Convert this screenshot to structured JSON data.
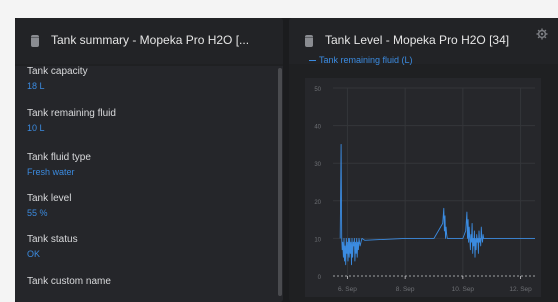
{
  "left_panel": {
    "title": "Tank summary - Mopeka Pro H2O [...",
    "fields": [
      {
        "label": "Tank capacity",
        "value": "18 L"
      },
      {
        "label": "Tank remaining fluid",
        "value": "10 L"
      },
      {
        "label": "Tank fluid type",
        "value": "Fresh water"
      },
      {
        "label": "Tank level",
        "value": "55 %"
      },
      {
        "label": "Tank status",
        "value": "OK"
      },
      {
        "label": "Tank custom name",
        "value": ""
      }
    ]
  },
  "right_panel": {
    "title": "Tank Level - Mopeka Pro H2O [34]",
    "legend": "Tank remaining fluid (L)",
    "icons": {
      "panel": "tank-icon",
      "settings": "gear-icon"
    }
  },
  "chart_data": {
    "type": "line",
    "series": [
      {
        "name": "Tank remaining fluid (L)",
        "x": [
          5.75,
          5.78,
          5.8,
          5.82,
          5.84,
          5.86,
          5.88,
          5.9,
          5.92,
          5.94,
          5.96,
          5.98,
          6.0,
          6.02,
          6.04,
          6.06,
          6.08,
          6.1,
          6.12,
          6.14,
          6.16,
          6.18,
          6.2,
          6.22,
          6.24,
          6.26,
          6.28,
          6.3,
          6.32,
          6.34,
          6.36,
          6.38,
          6.4,
          6.42,
          6.44,
          6.5,
          6.6,
          8.0,
          9.0,
          9.3,
          9.34,
          9.36,
          9.38,
          9.4,
          9.42,
          9.44,
          9.46,
          9.5,
          9.6,
          9.8,
          10.0,
          10.1,
          10.14,
          10.16,
          10.18,
          10.2,
          10.22,
          10.24,
          10.26,
          10.28,
          10.3,
          10.32,
          10.34,
          10.36,
          10.38,
          10.4,
          10.42,
          10.44,
          10.46,
          10.48,
          10.5,
          10.52,
          10.54,
          10.56,
          10.58,
          10.6,
          10.62,
          10.64,
          10.66,
          10.68,
          10.7,
          10.72,
          10.74,
          10.76,
          10.8,
          11.0,
          12.0,
          12.5
        ],
        "values": [
          10,
          35,
          10,
          7,
          9,
          5,
          10,
          4,
          8,
          3,
          10,
          6,
          9,
          4,
          10,
          5,
          10,
          6,
          9,
          3,
          10,
          5,
          9,
          8,
          10,
          4,
          9,
          6,
          10,
          5,
          9,
          7,
          10,
          9,
          8,
          10,
          9.5,
          10,
          10,
          14,
          18,
          12,
          16,
          10,
          13,
          11,
          10,
          10,
          10,
          10,
          10,
          12,
          17,
          10,
          15,
          9,
          13,
          10,
          7,
          11,
          9,
          14,
          6,
          10,
          8,
          12,
          5,
          10,
          7,
          11,
          9,
          10,
          6,
          12,
          9,
          10,
          8,
          13,
          10,
          9,
          11,
          10,
          10,
          10,
          10,
          10,
          10,
          10
        ]
      }
    ],
    "x_tick_labels": [
      "6. Sep",
      "8. Sep",
      "10. Sep",
      "12. Sep"
    ],
    "x_tick_values": [
      6,
      8,
      10,
      12
    ],
    "y_ticks": [
      0,
      10,
      20,
      30,
      40,
      50
    ],
    "xlim": [
      5.5,
      12.5
    ],
    "ylim": [
      0,
      50
    ],
    "grid": true
  }
}
